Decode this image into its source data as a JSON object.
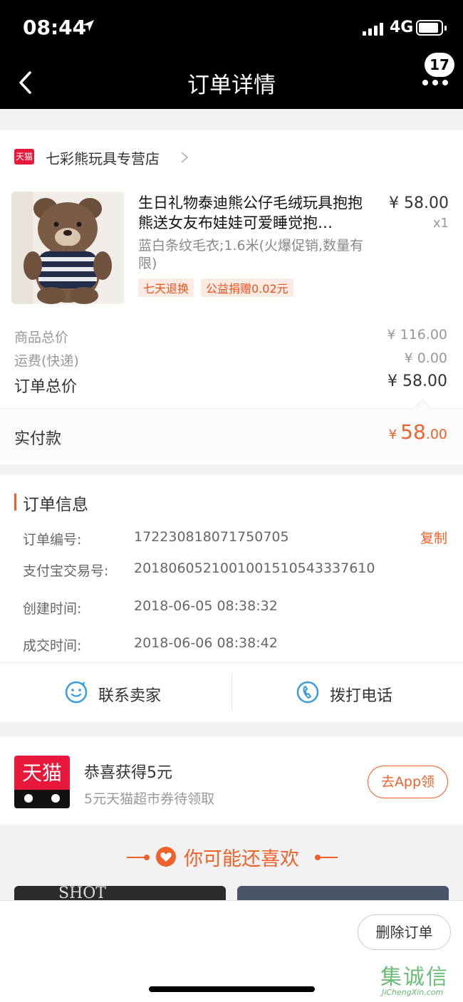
{
  "status_bar": {
    "time": "08:44",
    "network": "4G",
    "battery_level": 0.9
  },
  "nav": {
    "title": "订单详情",
    "badge": "17"
  },
  "store": {
    "logo_text": "天猫",
    "name": "七彩熊玩具专营店"
  },
  "product": {
    "title": "生日礼物泰迪熊公仔毛绒玩具抱抱熊送女友布娃娃可爱睡觉抱…",
    "sku": "蓝白条纹毛衣;1.6米(火爆促销,数量有限)",
    "tags": [
      "七天退换",
      "公益捐赠0.02元"
    ],
    "price": "¥ 58.00",
    "qty": "x1"
  },
  "summary": {
    "goods_total_label": "商品总价",
    "goods_total_value": "¥ 116.00",
    "shipping_label": "运费(快递)",
    "shipping_value": "¥ 0.00",
    "order_total_label": "订单总价",
    "order_total_value": "¥ 58.00",
    "paid_label": "实付款",
    "paid_symbol": "¥",
    "paid_int": "58",
    "paid_dec": ".00"
  },
  "order_info": {
    "title": "订单信息",
    "copy_label": "复制",
    "rows": [
      {
        "label": "订单编号:",
        "value": "172230818071750705"
      },
      {
        "label": "支付宝交易号:",
        "value": "2018060521001001510543337610"
      },
      {
        "label": "创建时间:",
        "value": "2018-06-05 08:38:32"
      },
      {
        "label": "成交时间:",
        "value": "2018-06-06 08:38:42"
      }
    ]
  },
  "actions": {
    "contact_seller": "联系卖家",
    "call": "拨打电话"
  },
  "coupon": {
    "logo_text": "天猫",
    "title": "恭喜获得5元",
    "subtitle": "5元天猫超市券待领取",
    "button": "去App领"
  },
  "recommend": {
    "title": "你可能还喜欢",
    "card_text": "SHOT"
  },
  "bottom": {
    "delete_button": "删除订单"
  },
  "watermark": {
    "cn": "集诚信",
    "en": "JiChengXin.com"
  },
  "colors": {
    "accent": "#f0612b",
    "tmall_red": "#e8183a",
    "nav_bg": "#000000"
  }
}
